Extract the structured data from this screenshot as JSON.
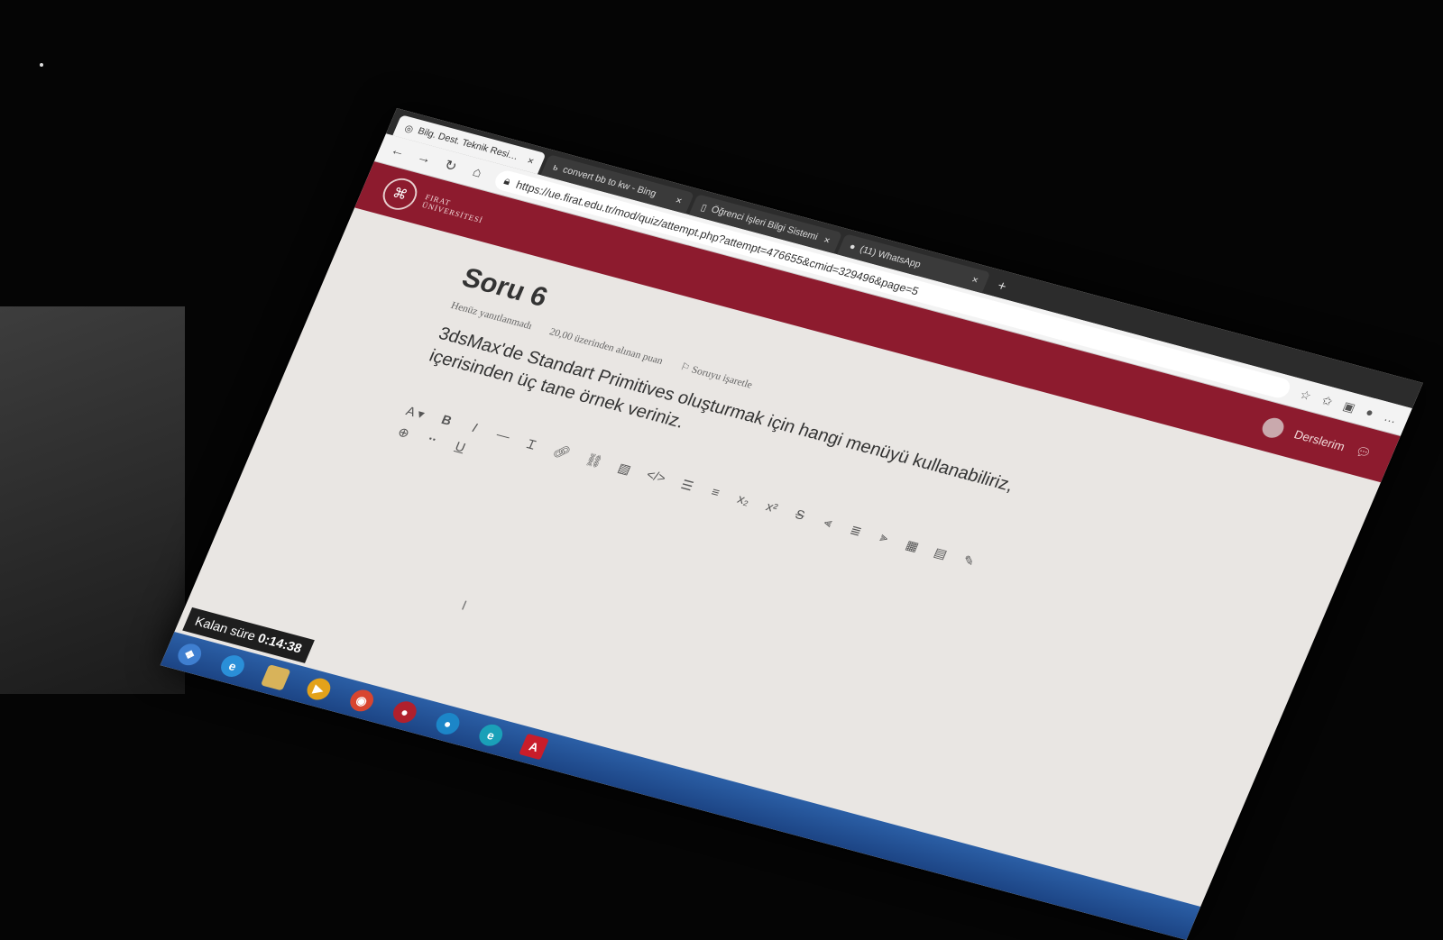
{
  "browser": {
    "tabs": [
      {
        "title": "Bilg. Dest. Teknik Resim Vize Sın",
        "close": "×",
        "active": true
      },
      {
        "title": "convert bb to kw - Bing",
        "close": "×",
        "active": false
      },
      {
        "title": "Öğrenci İşleri Bilgi Sistemi",
        "close": "×",
        "active": false
      },
      {
        "title": "(11) WhatsApp",
        "close": "×",
        "active": false
      }
    ],
    "new_tab": "+",
    "url": "https://ue.firat.edu.tr/mod/quiz/attempt.php?attempt=476655&cmid=329496&page=5"
  },
  "site": {
    "logo_line1": "FIRAT",
    "logo_line2": "ÜNİVERSİTESİ",
    "nav_label": "Derslerim"
  },
  "question": {
    "title": "Soru 6",
    "status": "Henüz yanıtlanmadı",
    "points": "20,00 üzerinden alınan puan",
    "flag_label": "Soruyu işaretle",
    "text": "3dsMax'de Standart Primitives oluşturmak için hangi menüyü kullanabiliriz, içerisinden üç tane örnek veriniz."
  },
  "editor": {
    "font_btn": "A ▾",
    "bold": "B",
    "italic": "I",
    "underline": "U",
    "subscript": "x₂",
    "superscript": "x²",
    "strike": "S"
  },
  "timer": {
    "label": "Kalan süre",
    "value": "0:14:38"
  },
  "colors": {
    "header": "#8d1b2e",
    "taskbar": "#2b5fa6"
  }
}
